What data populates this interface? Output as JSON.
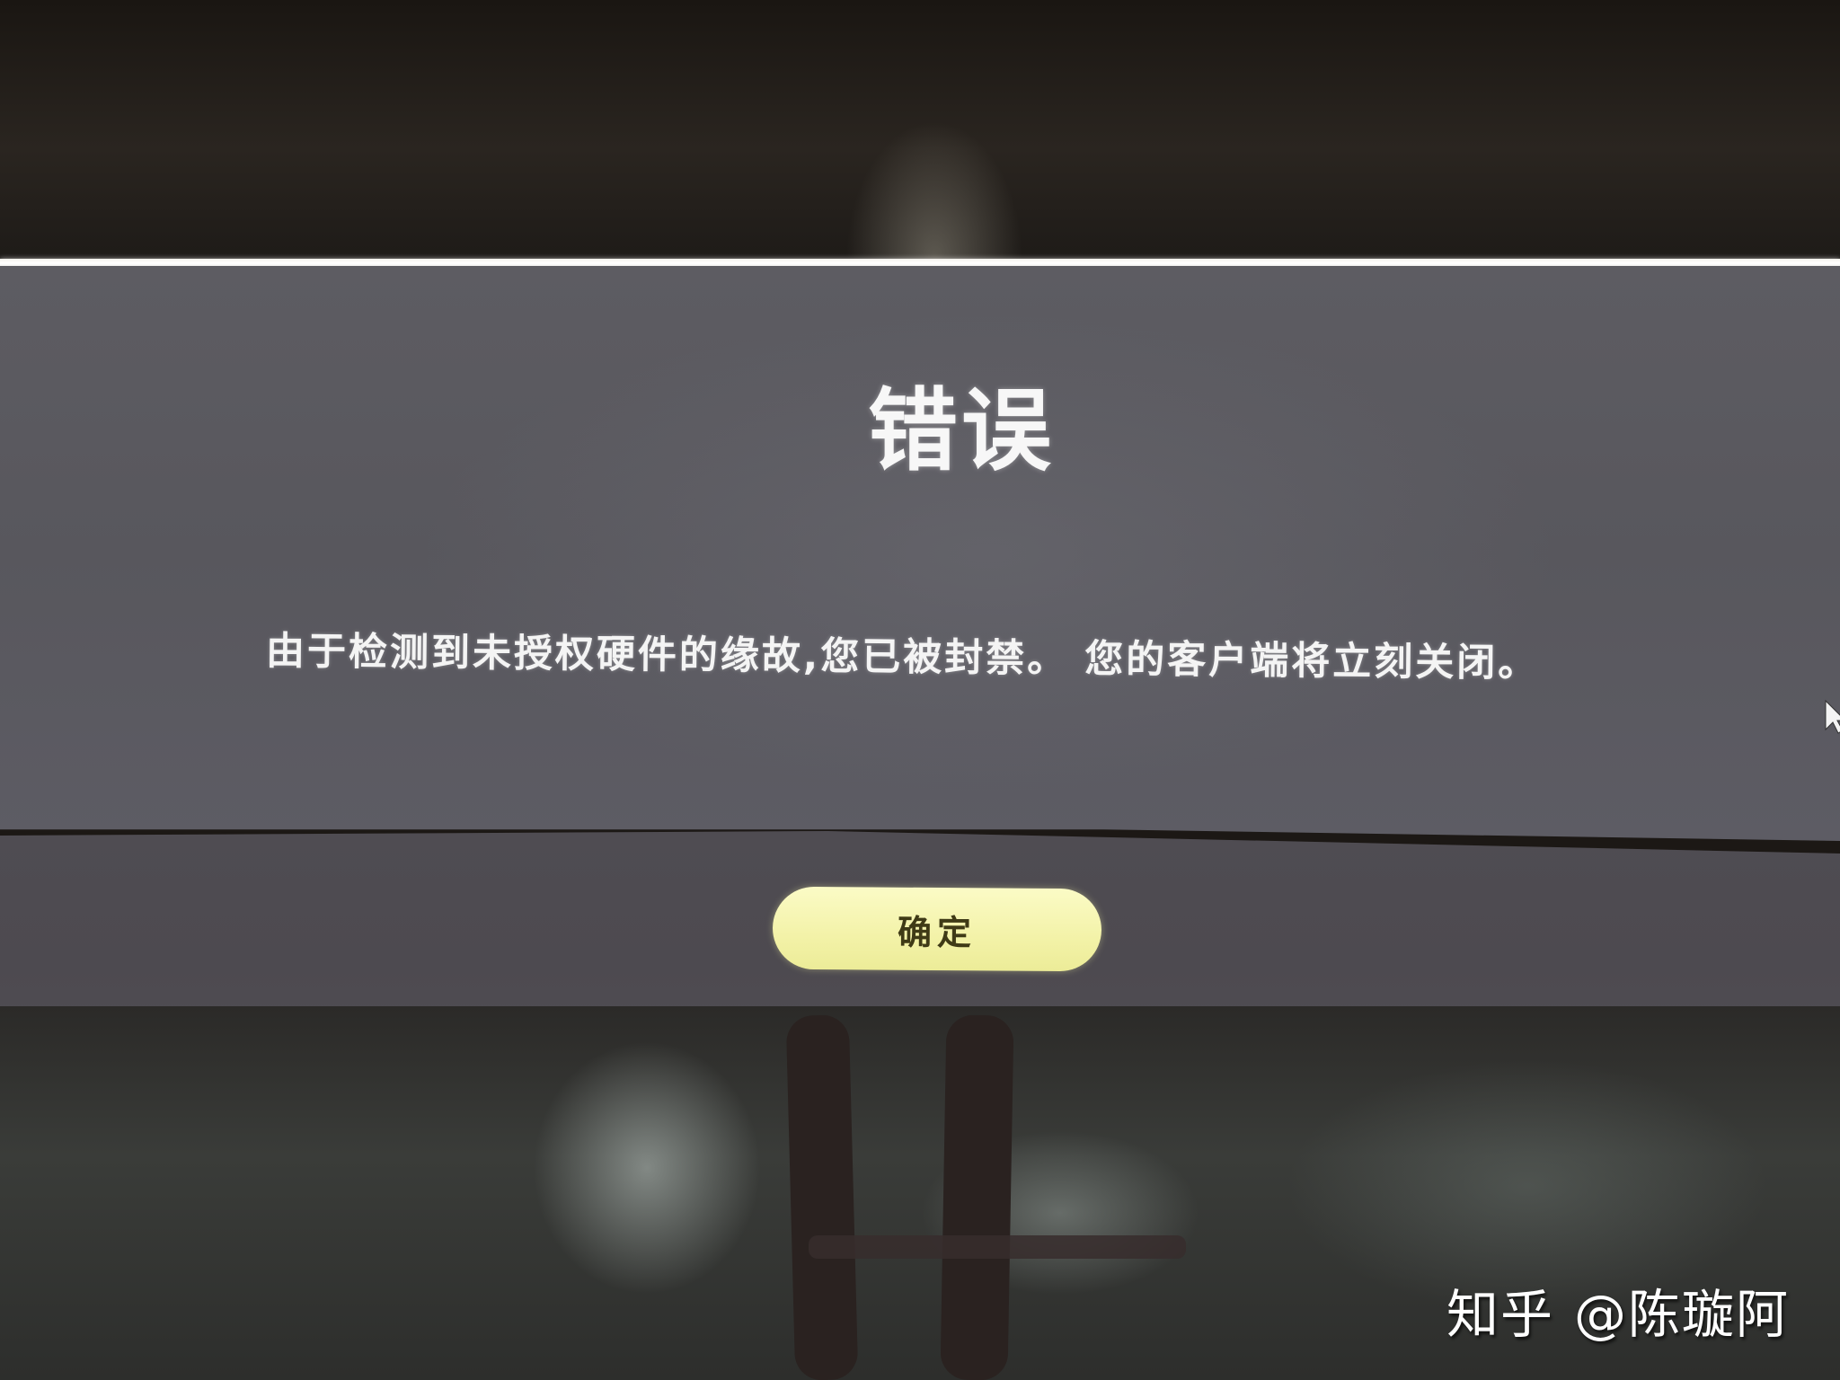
{
  "dialog": {
    "title": "错误",
    "message": "由于检测到未授权硬件的缘故,您已被封禁。 您的客户端将立刻关闭。",
    "confirm_button_label": "确定"
  },
  "watermark": {
    "brand": "知乎",
    "author": "@陈璇阿"
  },
  "colors": {
    "panel_background": "#5b5a60",
    "button_band_background": "#4e4b51",
    "confirm_button_fill": "#f6f5b0",
    "confirm_button_text": "#3f3a16",
    "title_text": "#f7f7f7"
  },
  "icons": {
    "cursor": "mouse-pointer-icon"
  }
}
